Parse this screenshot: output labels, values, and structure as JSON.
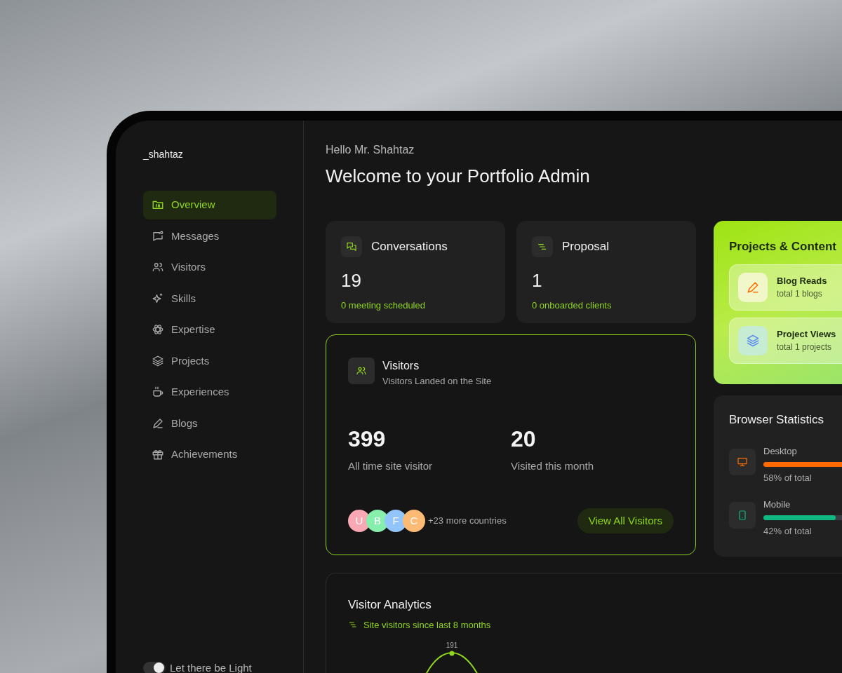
{
  "sidebar": {
    "brand": "_shahtaz",
    "items": [
      {
        "label": "Overview",
        "selected": true
      },
      {
        "label": "Messages",
        "selected": false
      },
      {
        "label": "Visitors",
        "selected": false
      },
      {
        "label": "Skills",
        "selected": false
      },
      {
        "label": "Expertise",
        "selected": false
      },
      {
        "label": "Projects",
        "selected": false
      },
      {
        "label": "Experiences",
        "selected": false
      },
      {
        "label": "Blogs",
        "selected": false
      },
      {
        "label": "Achievements",
        "selected": false
      }
    ],
    "theme_toggle": {
      "label": "Let there be Light",
      "on": true
    }
  },
  "header": {
    "greeting": "Hello Mr. Shahtaz",
    "title": "Welcome to your Portfolio Admin"
  },
  "stat_cards": [
    {
      "title": "Conversations",
      "value": "19",
      "note": "0 meeting scheduled"
    },
    {
      "title": "Proposal",
      "value": "1",
      "note": "0 onboarded clients"
    }
  ],
  "visitors": {
    "title": "Visitors",
    "subtitle": "Visitors Landed on the Site",
    "metrics": [
      {
        "value": "399",
        "label": "All time site visitor"
      },
      {
        "value": "20",
        "label": "Visited this month"
      }
    ],
    "countries": [
      {
        "letter": "U",
        "color": "#f9a8b4"
      },
      {
        "letter": "B",
        "color": "#86efac"
      },
      {
        "letter": "F",
        "color": "#93c5fd"
      },
      {
        "letter": "C",
        "color": "#fdba74"
      }
    ],
    "more": "+23 more countries",
    "button": "View All Visitors"
  },
  "projects_content": {
    "title": "Projects & Content",
    "items": [
      {
        "title": "Blog Reads",
        "note": "total 1 blogs"
      },
      {
        "title": "Project Views",
        "note": "total 1 projects"
      }
    ]
  },
  "browser_stats": {
    "title": "Browser Statistics",
    "items": [
      {
        "name": "Desktop",
        "level": 0.58,
        "reading": "58% of total",
        "color": "#ff6a00"
      },
      {
        "name": "Mobile",
        "level": 0.42,
        "reading": "42% of total",
        "color": "#10b981"
      }
    ]
  },
  "analytics": {
    "title": "Visitor Analytics",
    "subtitle": "Site visitors since last 8 months",
    "peak_label": "191"
  }
}
